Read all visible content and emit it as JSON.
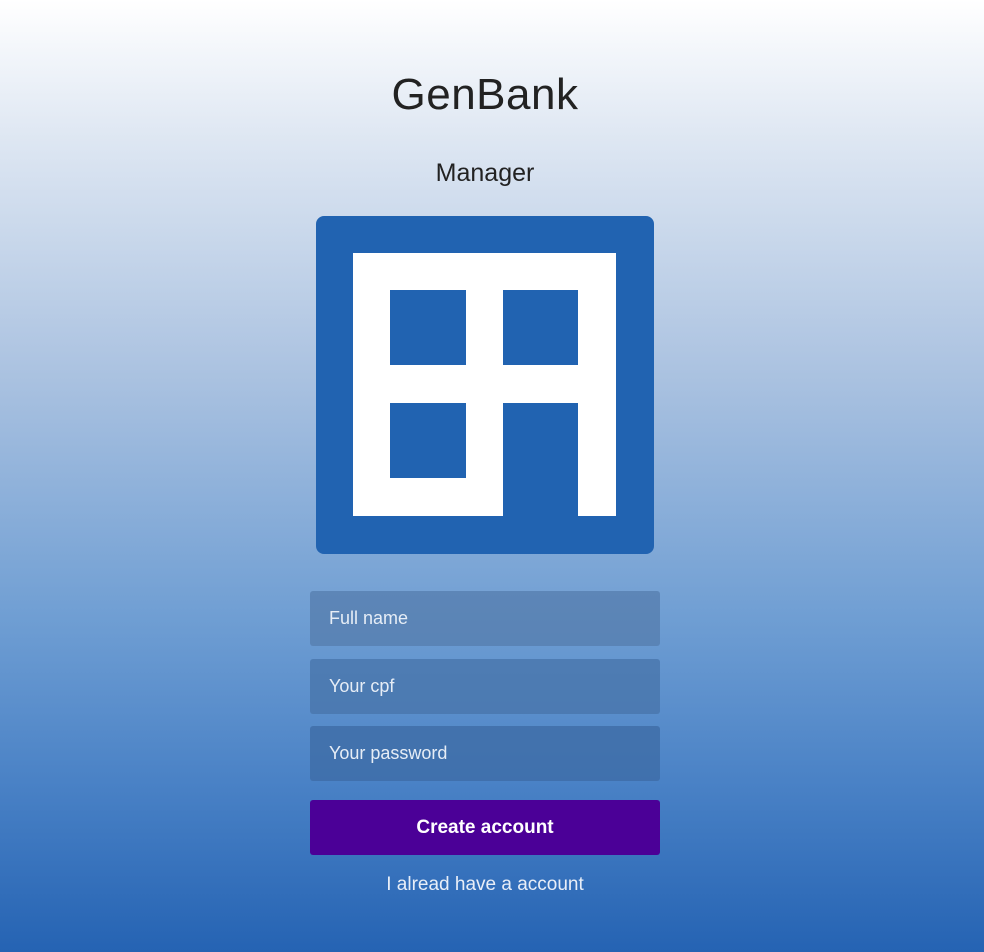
{
  "header": {
    "title": "GenBank",
    "subtitle": "Manager"
  },
  "logo": {
    "icon": "building-icon",
    "color": "#2163b1"
  },
  "form": {
    "full_name_placeholder": "Full name",
    "cpf_placeholder": "Your cpf",
    "password_placeholder": "Your password",
    "submit_label": "Create account",
    "login_link": "I alread have a account"
  },
  "colors": {
    "button": "#4b0097",
    "accent": "#2163b1"
  }
}
